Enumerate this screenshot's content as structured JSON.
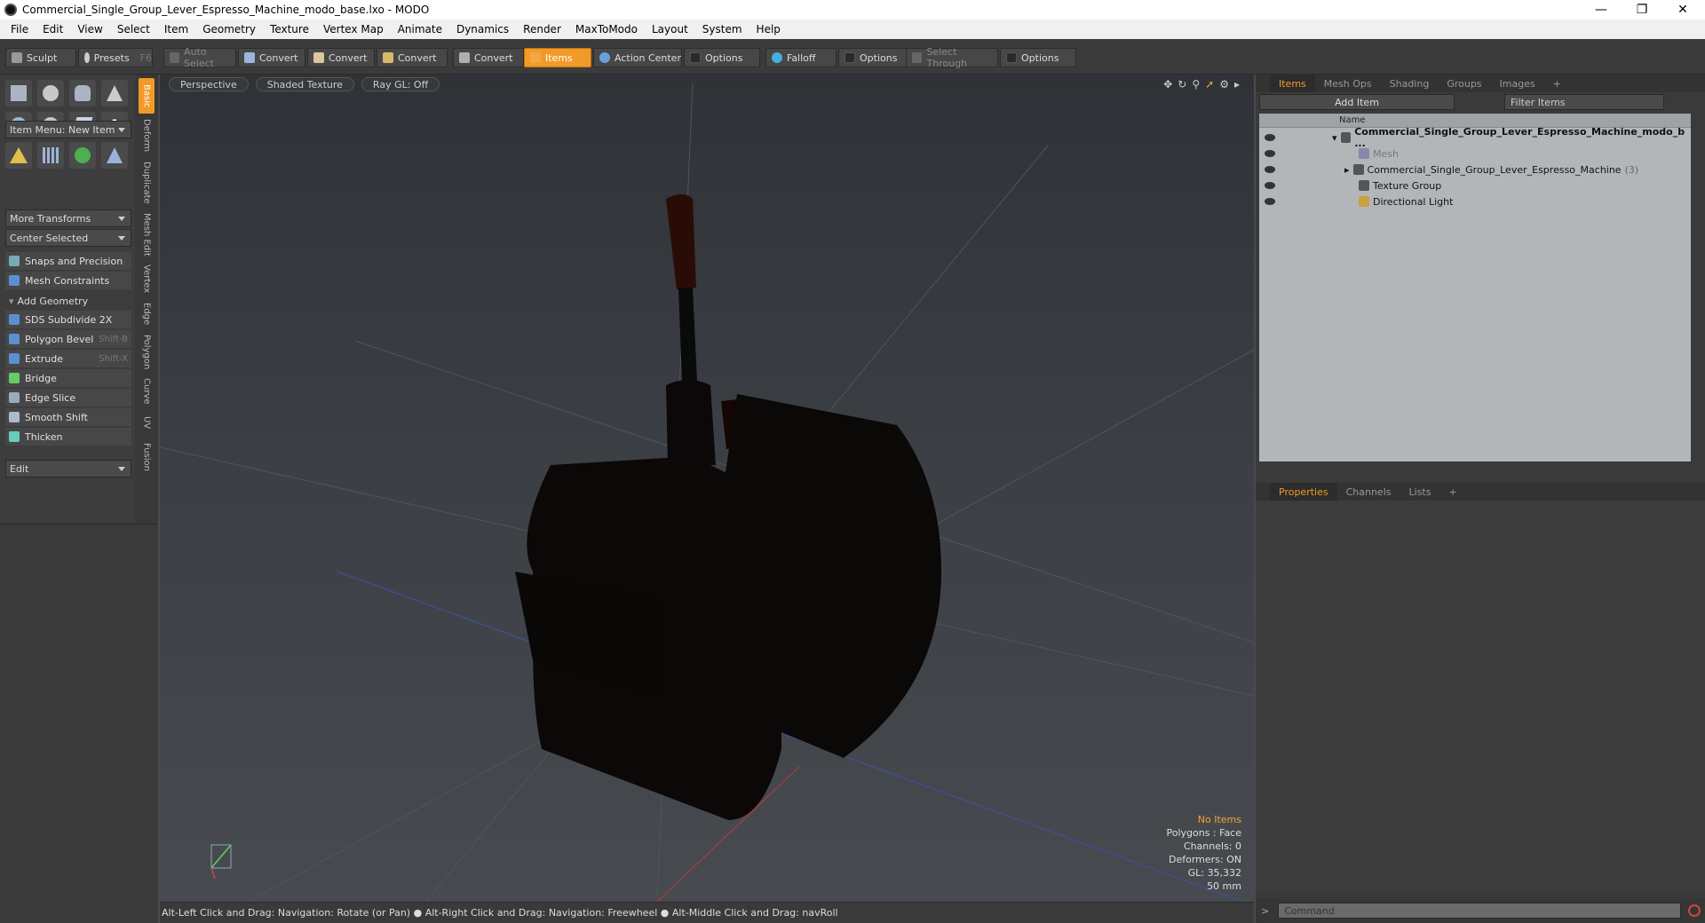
{
  "window": {
    "title": "Commercial_Single_Group_Lever_Espresso_Machine_modo_base.lxo - MODO"
  },
  "menu": [
    "File",
    "Edit",
    "View",
    "Select",
    "Item",
    "Geometry",
    "Texture",
    "Vertex Map",
    "Animate",
    "Dynamics",
    "Render",
    "MaxToModo",
    "Layout",
    "System",
    "Help"
  ],
  "toolbar": {
    "sculpt": "Sculpt",
    "presets": "Presets",
    "presets_shortcut": "F6",
    "auto_select": "Auto Select",
    "convert1": "Convert",
    "convert2": "Convert",
    "convert3": "Convert",
    "convert4": "Convert",
    "items": "Items",
    "action_center": "Action Center",
    "options1": "Options",
    "falloff": "Falloff",
    "options2": "Options",
    "select_through": "Select Through",
    "options3": "Options"
  },
  "left": {
    "item_menu": "Item Menu: New Item",
    "more_transforms": "More Transforms",
    "center_selected": "Center Selected",
    "snaps": "Snaps and Precision",
    "mesh_constraints": "Mesh Constraints",
    "add_geometry": "Add Geometry",
    "tools": [
      {
        "label": "SDS Subdivide 2X",
        "shortcut": ""
      },
      {
        "label": "Polygon Bevel",
        "shortcut": "Shift-B"
      },
      {
        "label": "Extrude",
        "shortcut": "Shift-X"
      },
      {
        "label": "Bridge",
        "shortcut": ""
      },
      {
        "label": "Edge Slice",
        "shortcut": ""
      },
      {
        "label": "Smooth Shift",
        "shortcut": ""
      },
      {
        "label": "Thicken",
        "shortcut": ""
      }
    ],
    "edit_dropdown": "Edit",
    "vtabs": [
      "Basic",
      "Deform",
      "Duplicate",
      "Mesh Edit",
      "Vertex",
      "Edge",
      "Polygon",
      "Curve",
      "UV",
      "Fusion"
    ]
  },
  "viewport": {
    "view": "Perspective",
    "shading": "Shaded Texture",
    "raygl": "Ray GL: Off",
    "hud": {
      "no_items": "No Items",
      "polygons": "Polygons : Face",
      "channels": "Channels: 0",
      "deformers": "Deformers: ON",
      "gl": "GL: 35,332",
      "scale": "50 mm"
    }
  },
  "status": "Alt-Left Click and Drag: Navigation: Rotate (or Pan) ● Alt-Right Click and Drag: Navigation: Freewheel ● Alt-Middle Click and Drag: navRoll",
  "right": {
    "tabs": [
      "Items",
      "Mesh Ops",
      "Shading",
      "Groups",
      "Images"
    ],
    "add_item": "Add Item",
    "filter_items": "Filter Items",
    "name_col": "Name",
    "tree": [
      {
        "label": "Commercial_Single_Group_Lever_Espresso_Machine_modo_b ...",
        "count": ""
      },
      {
        "label": "Mesh",
        "count": ""
      },
      {
        "label": "Commercial_Single_Group_Lever_Espresso_Machine",
        "count": "(3)"
      },
      {
        "label": "Texture Group",
        "count": ""
      },
      {
        "label": "Directional Light",
        "count": ""
      }
    ],
    "prop_tabs": [
      "Properties",
      "Channels",
      "Lists"
    ],
    "command_placeholder": "Command"
  }
}
